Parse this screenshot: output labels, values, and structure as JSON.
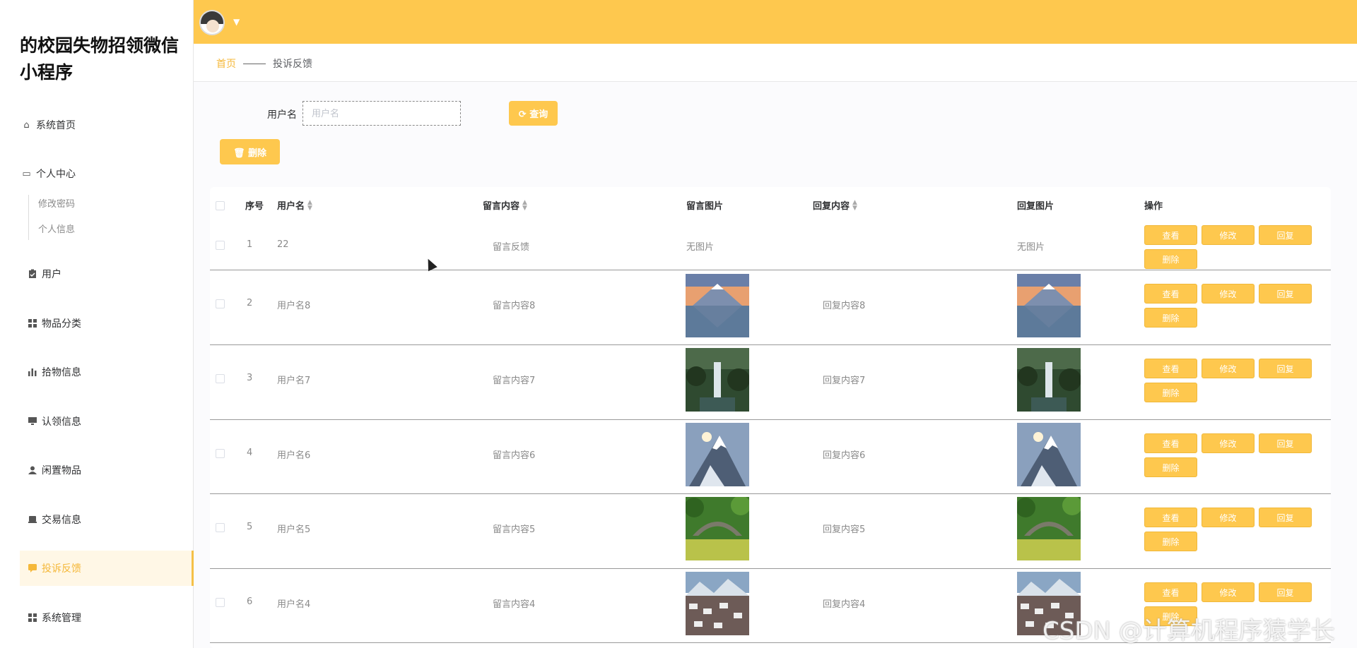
{
  "app": {
    "title": "的校园失物招领微信小程序"
  },
  "sidebar": {
    "items": [
      {
        "label": "系统首页",
        "icon": "home-icon"
      },
      {
        "label": "个人中心",
        "icon": "profile-icon"
      },
      {
        "label": "修改密码"
      },
      {
        "label": "个人信息"
      },
      {
        "label": "用户",
        "icon": "clipboard-icon"
      },
      {
        "label": "物品分类",
        "icon": "grid-icon"
      },
      {
        "label": "拾物信息",
        "icon": "bar-chart-icon"
      },
      {
        "label": "认领信息",
        "icon": "monitor-icon"
      },
      {
        "label": "闲置物品",
        "icon": "user-icon"
      },
      {
        "label": "交易信息",
        "icon": "printer-icon"
      },
      {
        "label": "投诉反馈",
        "icon": "message-icon"
      },
      {
        "label": "系统管理",
        "icon": "grid-icon"
      }
    ],
    "active": "投诉反馈"
  },
  "breadcrumb": {
    "home": "首页",
    "current": "投诉反馈"
  },
  "search": {
    "label": "用户名",
    "placeholder": "用户名",
    "query_label": "查询"
  },
  "toolbar": {
    "delete_label": "删除"
  },
  "table": {
    "headers": {
      "index": "序号",
      "username": "用户名",
      "message": "留言内容",
      "message_image": "留言图片",
      "reply": "回复内容",
      "reply_image": "回复图片",
      "actions": "操作"
    },
    "op_labels": {
      "view": "查看",
      "edit": "修改",
      "reply": "回复",
      "delete": "删除"
    },
    "rows": [
      {
        "index": "1",
        "username": "22",
        "message": "留言反馈",
        "message_image": "无图片",
        "reply": "",
        "reply_image": "无图片"
      },
      {
        "index": "2",
        "username": "用户名8",
        "message": "留言内容8",
        "reply": "回复内容8",
        "scene": "mountain-lake"
      },
      {
        "index": "3",
        "username": "用户名7",
        "message": "留言内容7",
        "reply": "回复内容7",
        "scene": "waterfall"
      },
      {
        "index": "4",
        "username": "用户名6",
        "message": "留言内容6",
        "reply": "回复内容6",
        "scene": "snow-peak"
      },
      {
        "index": "5",
        "username": "用户名5",
        "message": "留言内容5",
        "reply": "回复内容5",
        "scene": "stone-bridge"
      },
      {
        "index": "6",
        "username": "用户名4",
        "message": "留言内容4",
        "reply": "回复内容4",
        "scene": "snow-village"
      }
    ]
  },
  "watermark": "CSDN @计算机程序猿学长",
  "colors": {
    "accent": "#fec84e",
    "active_text": "#f5b83a"
  }
}
